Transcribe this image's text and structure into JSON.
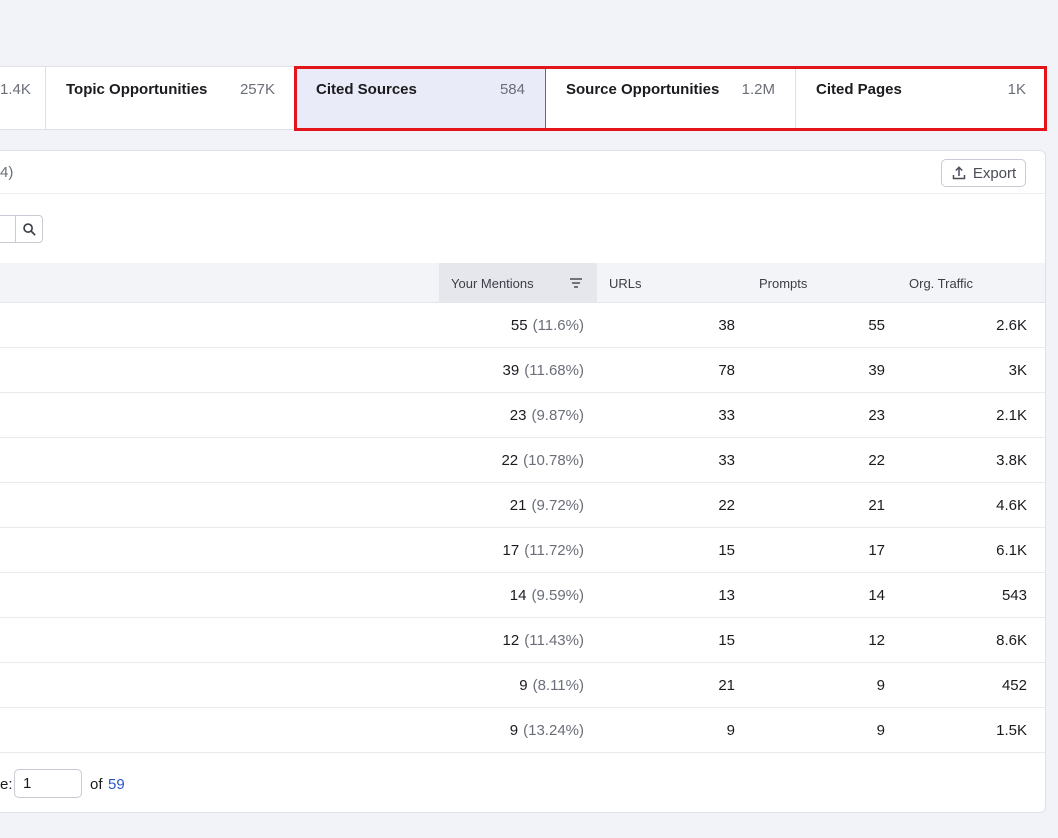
{
  "tabs": {
    "partial": {
      "count": "1.4K"
    },
    "items": [
      {
        "label": "Topic Opportunities",
        "count": "257K"
      },
      {
        "label": "Cited Sources",
        "count": "584"
      },
      {
        "label": "Source Opportunities",
        "count": "1.2M"
      },
      {
        "label": "Cited Pages",
        "count": "1K"
      }
    ],
    "highlight_color": "#e4141b"
  },
  "card": {
    "count_fragment": "4)",
    "export_label": "Export"
  },
  "table": {
    "columns": {
      "mentions": "Your Mentions",
      "urls": "URLs",
      "prompts": "Prompts",
      "traffic": "Org. Traffic"
    },
    "rows": [
      {
        "mentions": "55",
        "pct": "(11.6%)",
        "urls": "38",
        "prompts": "55",
        "traffic": "2.6K"
      },
      {
        "mentions": "39",
        "pct": "(11.68%)",
        "urls": "78",
        "prompts": "39",
        "traffic": "3K"
      },
      {
        "mentions": "23",
        "pct": "(9.87%)",
        "urls": "33",
        "prompts": "23",
        "traffic": "2.1K"
      },
      {
        "mentions": "22",
        "pct": "(10.78%)",
        "urls": "33",
        "prompts": "22",
        "traffic": "3.8K"
      },
      {
        "mentions": "21",
        "pct": "(9.72%)",
        "urls": "22",
        "prompts": "21",
        "traffic": "4.6K"
      },
      {
        "mentions": "17",
        "pct": "(11.72%)",
        "urls": "15",
        "prompts": "17",
        "traffic": "6.1K"
      },
      {
        "mentions": "14",
        "pct": "(9.59%)",
        "urls": "13",
        "prompts": "14",
        "traffic": "543"
      },
      {
        "mentions": "12",
        "pct": "(11.43%)",
        "urls": "15",
        "prompts": "12",
        "traffic": "8.6K"
      },
      {
        "mentions": "9",
        "pct": "(8.11%)",
        "urls": "21",
        "prompts": "9",
        "traffic": "452"
      },
      {
        "mentions": "9",
        "pct": "(13.24%)",
        "urls": "9",
        "prompts": "9",
        "traffic": "1.5K"
      }
    ]
  },
  "pager": {
    "label_fragment": "e:",
    "page_value": "1",
    "of_text": "of",
    "total_pages": "59"
  }
}
